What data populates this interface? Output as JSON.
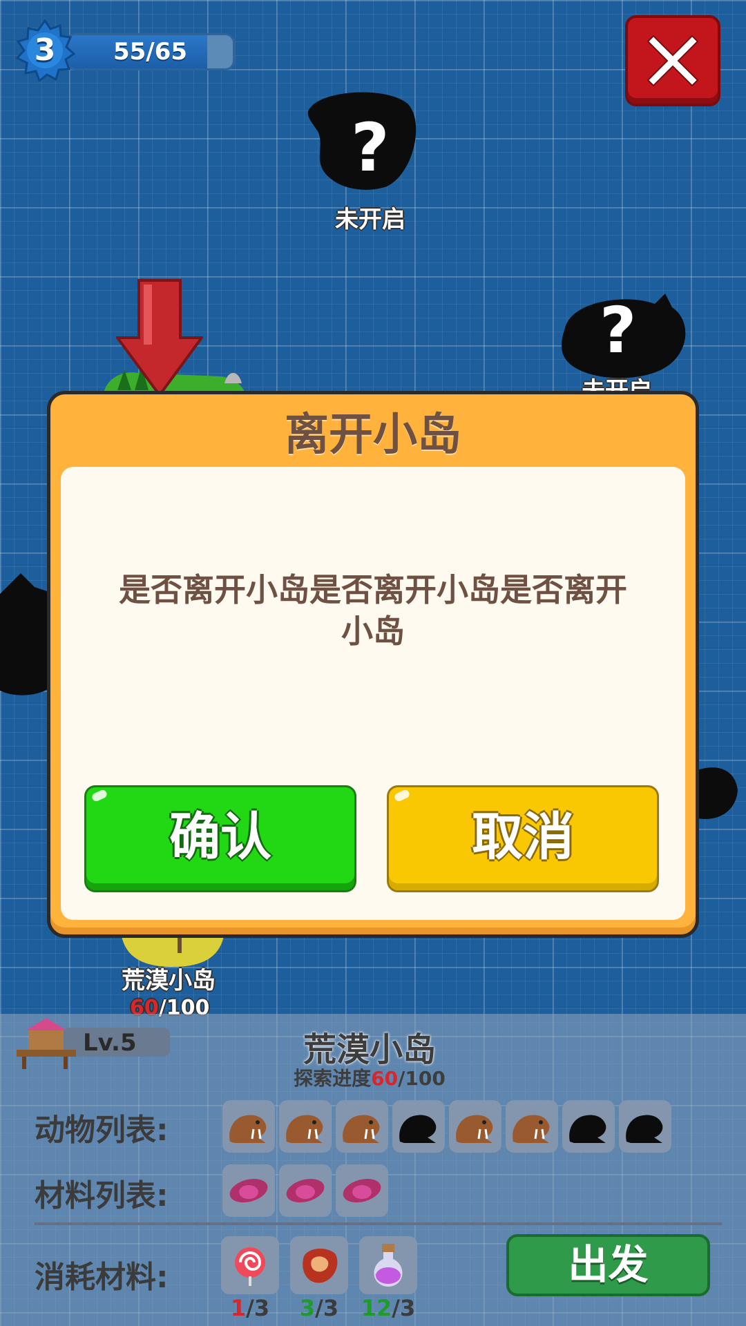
{
  "hud": {
    "level": "3",
    "xp_text": "55/65",
    "xp_progress": 0.846
  },
  "map": {
    "locked_label": "未开启",
    "question_mark": "?",
    "desert_island_label": "荒漠小岛",
    "desert_island_progress_current": "60",
    "desert_island_progress_total": "/100"
  },
  "info_panel": {
    "level_text": "Lv.5",
    "island_name": "荒漠小岛",
    "progress_prefix": "探索进度",
    "progress_current": "60",
    "progress_total": "/100",
    "animals_label": "动物列表:",
    "animals": [
      {
        "icon": "walrus-icon",
        "unlocked": true
      },
      {
        "icon": "walrus-icon",
        "unlocked": true
      },
      {
        "icon": "walrus-icon",
        "unlocked": true
      },
      {
        "icon": "walrus-silhouette-icon",
        "unlocked": false
      },
      {
        "icon": "walrus-icon",
        "unlocked": true
      },
      {
        "icon": "walrus-icon",
        "unlocked": true
      },
      {
        "icon": "walrus-silhouette-icon",
        "unlocked": false
      },
      {
        "icon": "walrus-silhouette-icon",
        "unlocked": false
      }
    ],
    "materials_label": "材料列表:",
    "materials": [
      "sweet-potato-icon",
      "sweet-potato-icon",
      "sweet-potato-icon"
    ],
    "consume_label": "消耗材料:",
    "consumables": [
      {
        "icon": "lollipop-icon",
        "have": "1",
        "need": "/3",
        "color": "#d9262c"
      },
      {
        "icon": "meat-icon",
        "have": "3",
        "need": "/3",
        "color": "#1f9a2e"
      },
      {
        "icon": "potion-icon",
        "have": "12",
        "need": "/3",
        "color": "#1f9a2e"
      }
    ],
    "go_button": "出发"
  },
  "dialog": {
    "title": "离开小岛",
    "message": "是否离开小岛是否离开小岛是否离开小岛",
    "confirm": "确认",
    "cancel": "取消"
  },
  "colors": {
    "background": "#1d5e9c",
    "dialog_frame": "#ffb23c",
    "confirm_green": "#22d814",
    "cancel_yellow": "#fac802",
    "close_red": "#c2151c",
    "go_green": "#2f9a4a",
    "title_brown": "#6f5143"
  }
}
